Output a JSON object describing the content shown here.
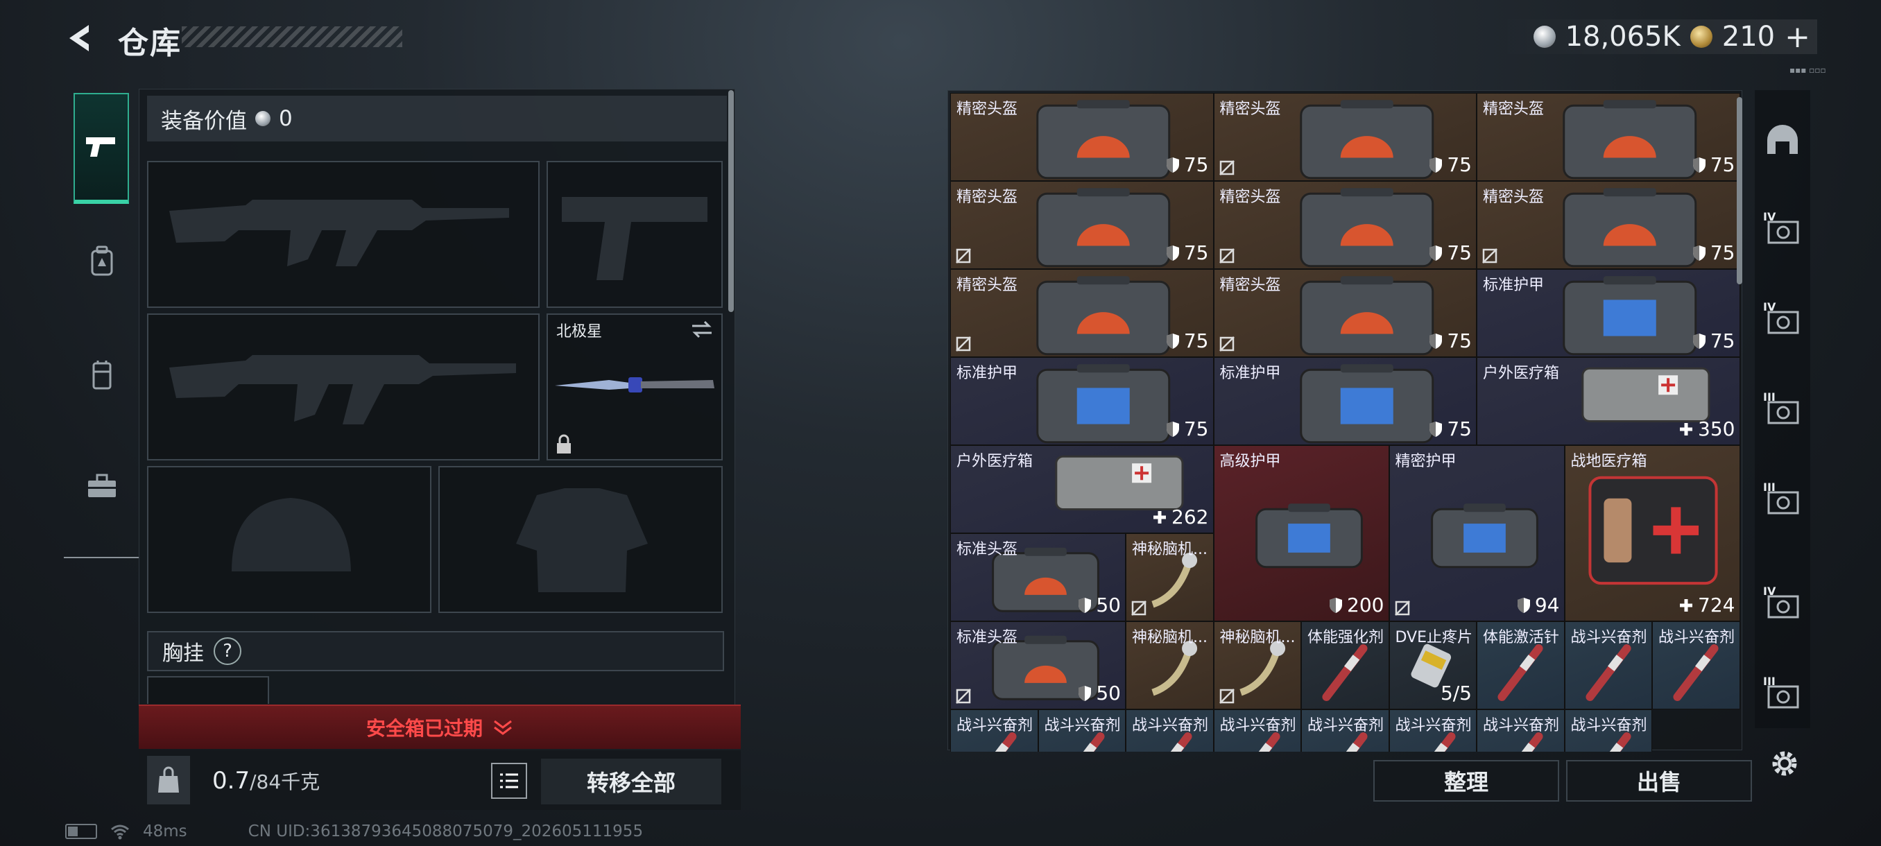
{
  "header": {
    "title": "仓库",
    "silver": "18,065K",
    "gold": "210",
    "gold_add": "+"
  },
  "left_panel": {
    "equip_value_label": "装备价值",
    "equip_value": "0",
    "knife_name": "北极星",
    "chest_label": "胸挂",
    "chest_help": "?",
    "safe_box_status": "安全箱已过期",
    "weight_value": "0.7",
    "weight_capacity": "/84千克",
    "transfer_all": "转移全部"
  },
  "inventory": {
    "items": [
      {
        "name": "精密头盔",
        "value": "75",
        "kind": "helmet",
        "tagged": false
      },
      {
        "name": "精密头盔",
        "value": "75",
        "kind": "helmet",
        "tagged": true
      },
      {
        "name": "精密头盔",
        "value": "75",
        "kind": "helmet",
        "tagged": false
      },
      {
        "name": "精密头盔",
        "value": "75",
        "kind": "helmet",
        "tagged": true
      },
      {
        "name": "精密头盔",
        "value": "75",
        "kind": "helmet",
        "tagged": true
      },
      {
        "name": "精密头盔",
        "value": "75",
        "kind": "helmet",
        "tagged": true
      },
      {
        "name": "精密头盔",
        "value": "75",
        "kind": "helmet",
        "tagged": true
      },
      {
        "name": "精密头盔",
        "value": "75",
        "kind": "helmet",
        "tagged": true
      },
      {
        "name": "标准护甲",
        "value": "75",
        "kind": "armor",
        "tagged": false
      },
      {
        "name": "标准护甲",
        "value": "75",
        "kind": "armor",
        "tagged": false
      },
      {
        "name": "标准护甲",
        "value": "75",
        "kind": "armor",
        "tagged": false
      },
      {
        "name": "户外医疗箱",
        "value": "350",
        "kind": "medbag",
        "tagged": false
      },
      {
        "name": "户外医疗箱",
        "value": "262",
        "kind": "medbag",
        "tagged": false
      },
      {
        "name": "高级护甲",
        "value": "200",
        "kind": "armor",
        "tagged": false
      },
      {
        "name": "精密护甲",
        "value": "94",
        "kind": "armor",
        "tagged": true
      },
      {
        "name": "战地医疗箱",
        "value": "724",
        "kind": "firstaid",
        "tagged": false
      },
      {
        "name": "标准头盔",
        "value": "50",
        "kind": "helmet",
        "tagged": false
      },
      {
        "name": "神秘脑机...",
        "value": "",
        "kind": "cable",
        "tagged": true
      },
      {
        "name": "标准头盔",
        "value": "50",
        "kind": "helmet",
        "tagged": true
      },
      {
        "name": "神秘脑机...",
        "value": "",
        "kind": "cable",
        "tagged": false
      },
      {
        "name": "神秘脑机...",
        "value": "",
        "kind": "cable",
        "tagged": true
      },
      {
        "name": "体能强化剂",
        "value": "",
        "kind": "syringe",
        "tagged": false
      },
      {
        "name": "DVE止疼片",
        "value": "5/5",
        "kind": "pills",
        "tagged": false
      },
      {
        "name": "体能激活针",
        "value": "",
        "kind": "syringe",
        "tagged": false
      },
      {
        "name": "战斗兴奋剂",
        "value": "",
        "kind": "syringe",
        "tagged": false
      },
      {
        "name": "战斗兴奋剂",
        "value": "",
        "kind": "syringe",
        "tagged": false
      },
      {
        "name": "战斗兴奋剂",
        "value": "",
        "kind": "syringe",
        "tagged": false
      },
      {
        "name": "战斗兴奋剂",
        "value": "",
        "kind": "syringe",
        "tagged": false
      },
      {
        "name": "战斗兴奋剂",
        "value": "",
        "kind": "syringe",
        "tagged": false
      },
      {
        "name": "战斗兴奋剂",
        "value": "",
        "kind": "syringe",
        "tagged": false
      },
      {
        "name": "战斗兴奋剂",
        "value": "",
        "kind": "syringe",
        "tagged": false
      },
      {
        "name": "战斗兴奋剂",
        "value": "",
        "kind": "syringe",
        "tagged": false
      },
      {
        "name": "战斗兴奋剂",
        "value": "",
        "kind": "syringe",
        "tagged": false
      },
      {
        "name": "战斗兴奋剂",
        "value": "",
        "kind": "syringe",
        "tagged": false
      }
    ],
    "sort_label": "整理",
    "sell_label": "出售"
  },
  "right_nav": {
    "tier_labels": [
      "IV",
      "IV",
      "III",
      "III",
      "IV",
      "III"
    ]
  },
  "status_bar": {
    "ping": "48ms",
    "uid": "CN UID:3613879364508807507​9_202605111955"
  },
  "icons": [
    "back-arrow-icon",
    "pistol-icon",
    "backpack-icon",
    "vest-icon",
    "toolbox-icon",
    "shield-icon",
    "swap-icon",
    "lock-icon",
    "bag-weight-icon",
    "list-icon",
    "gear-icon",
    "wifi-icon",
    "battery-icon"
  ],
  "colors": {
    "accent_teal": "#39d2a6",
    "danger_red": "#ff4a4a",
    "cell_brown": "#4a3a2c",
    "cell_navy": "#2e3042",
    "cell_red": "#5a2228"
  }
}
